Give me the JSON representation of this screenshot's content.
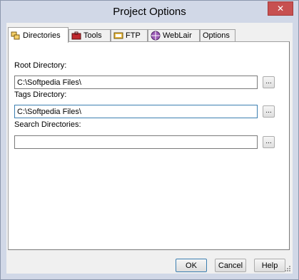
{
  "window": {
    "title": "Project Options",
    "close_label": "✕"
  },
  "tabs": [
    {
      "label": "Directories",
      "icon": "directories-icon",
      "active": true
    },
    {
      "label": "Tools",
      "icon": "toolbox-icon",
      "active": false
    },
    {
      "label": "FTP",
      "icon": "ftp-icon",
      "active": false
    },
    {
      "label": "WebLair",
      "icon": "weblair-icon",
      "active": false
    },
    {
      "label": "Options",
      "icon": "",
      "active": false
    }
  ],
  "fields": {
    "root": {
      "label": "Root Directory:",
      "value": "C:\\Softpedia Files\\",
      "browse": "..."
    },
    "tags": {
      "label": "Tags Directory:",
      "value": "C:\\Softpedia Files\\",
      "browse": "..."
    },
    "search": {
      "label": "Search Directories:",
      "value": "",
      "browse": "..."
    }
  },
  "buttons": {
    "ok": "OK",
    "cancel": "Cancel",
    "help": "Help"
  },
  "colors": {
    "frame": "#d1d8e7",
    "close": "#c75050",
    "focus_border": "#3c7fb1"
  }
}
